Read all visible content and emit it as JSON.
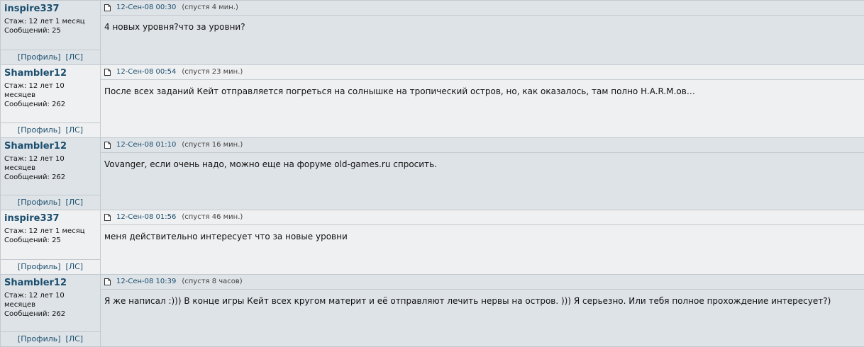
{
  "posts": [
    {
      "author": "inspire337",
      "stazh_label": "Стаж:",
      "stazh_value": "12 лет 1 месяц",
      "msgs_label": "Сообщений:",
      "msgs_value": "25",
      "profile_link": "[Профиль]",
      "pm_link": "[ЛС]",
      "date": "12-Сен-08 00:30",
      "ago": "(спустя 4 мин.)",
      "text": "4 новых уровня?что за уровни?"
    },
    {
      "author": "Shambler12",
      "stazh_label": "Стаж:",
      "stazh_value": "12 лет 10 месяцев",
      "msgs_label": "Сообщений:",
      "msgs_value": "262",
      "profile_link": "[Профиль]",
      "pm_link": "[ЛС]",
      "date": "12-Сен-08 00:54",
      "ago": "(спустя 23 мин.)",
      "text": "После всех заданий Кейт отправляется погреться на солнышке на тропический остров, но, как оказалось, там полно H.A.R.M.ов…"
    },
    {
      "author": "Shambler12",
      "stazh_label": "Стаж:",
      "stazh_value": "12 лет 10 месяцев",
      "msgs_label": "Сообщений:",
      "msgs_value": "262",
      "profile_link": "[Профиль]",
      "pm_link": "[ЛС]",
      "date": "12-Сен-08 01:10",
      "ago": "(спустя 16 мин.)",
      "text": "Vovanger, если очень надо, можно еще на форуме old-games.ru спросить."
    },
    {
      "author": "inspire337",
      "stazh_label": "Стаж:",
      "stazh_value": "12 лет 1 месяц",
      "msgs_label": "Сообщений:",
      "msgs_value": "25",
      "profile_link": "[Профиль]",
      "pm_link": "[ЛС]",
      "date": "12-Сен-08 01:56",
      "ago": "(спустя 46 мин.)",
      "text": "меня действительно интересует что за новые уровни"
    },
    {
      "author": "Shambler12",
      "stazh_label": "Стаж:",
      "stazh_value": "12 лет 10 месяцев",
      "msgs_label": "Сообщений:",
      "msgs_value": "262",
      "profile_link": "[Профиль]",
      "pm_link": "[ЛС]",
      "date": "12-Сен-08 10:39",
      "ago": "(спустя 8 часов)",
      "text": "Я же написал :))) В конце игры Кейт всех кругом материт и её отправляют лечить нервы на остров. ))) Я серьезно. Или тебя полное прохождение интересует?)"
    }
  ],
  "icons": {
    "post_icon": "document-icon"
  },
  "colors": {
    "nick": "#1a4e6e",
    "row_alt_bg": "#dee3e7",
    "row_bg": "#eff0f1",
    "border": "#c2c9cf"
  }
}
